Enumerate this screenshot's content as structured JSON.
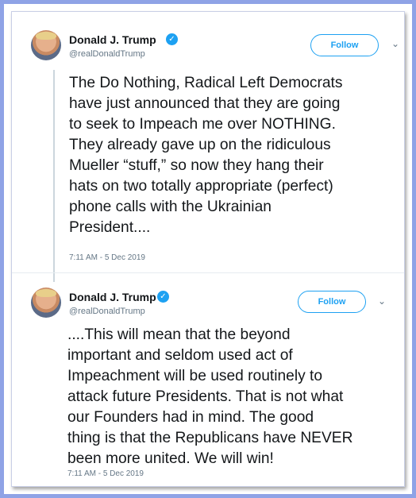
{
  "tweets": [
    {
      "author_name": "Donald J. Trump",
      "handle": "@realDonaldTrump",
      "follow_label": "Follow",
      "text": "The Do Nothing, Radical Left Democrats\nhave just announced that they are going\nto seek to Impeach me over NOTHING.\nThey already gave up on the ridiculous\nMueller “stuff,” so now they hang their\nhats on two totally appropriate (perfect)\nphone calls with the Ukrainian\nPresident....",
      "timestamp": "7:11 AM - 5 Dec 2019"
    },
    {
      "author_name": "Donald J. Trump",
      "handle": "@realDonaldTrump",
      "follow_label": "Follow",
      "text": "....This will mean that the beyond\nimportant and seldom used act of\nImpeachment will be used routinely to\nattack future Presidents. That is not what\nour Founders had in mind. The good\nthing is that the Republicans have NEVER\nbeen more united. We will win!",
      "timestamp": "7:11 AM - 5 Dec 2019"
    }
  ],
  "icons": {
    "verified": "verified-badge-icon",
    "menu": "chevron-down-icon"
  },
  "colors": {
    "accent": "#1da1f2",
    "frame": "#8fa3e6",
    "text": "#14171a",
    "secondary": "#657786"
  }
}
